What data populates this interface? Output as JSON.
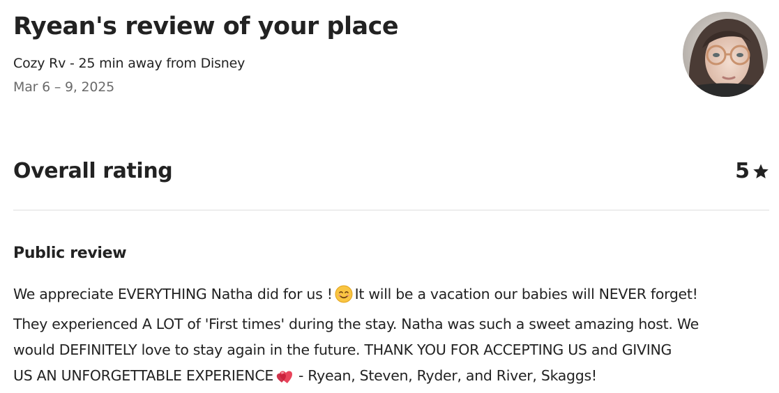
{
  "header": {
    "title": "Ryean's review of your place",
    "listing_name": "Cozy Rv - 25 min away from Disney",
    "stay_dates": "Mar 6 – 9, 2025"
  },
  "reviewer": {
    "avatar_icon": "reviewer-photo"
  },
  "rating": {
    "label": "Overall rating",
    "value": "5",
    "icon": "star-icon"
  },
  "public_review": {
    "section_title": "Public review",
    "line1a": "We appreciate EVERYTHING Natha did for us !",
    "emoji1": "smiling-face-emoji",
    "line1b": "It will be a vacation our babies will NEVER forget!",
    "line2": "They experienced A LOT of 'First times' during the stay. Natha was such a sweet amazing host. We",
    "line3": "would DEFINITELY love to stay again in the future. THANK YOU FOR ACCEPTING US and GIVING",
    "line4a": "US AN UNFORGETTABLE EXPERIENCE",
    "emoji2": "two-hearts-emoji",
    "line4b": "- Ryean, Steven, Ryder, and River, Skaggs!"
  },
  "colors": {
    "text_primary": "#222222",
    "text_secondary": "#6a6a6a",
    "divider": "#dddddd"
  }
}
